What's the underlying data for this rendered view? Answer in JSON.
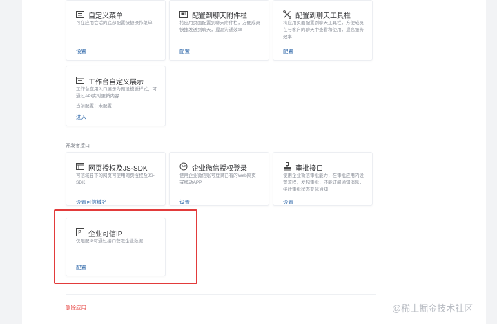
{
  "cards": [
    {
      "title": "自定义菜单",
      "desc": "可在应用会话的底部配置快捷操作菜单",
      "link": "设置",
      "icon": "menu-icon"
    },
    {
      "title": "配置到聊天附件栏",
      "desc": "将应用页面配置到聊天附件栏，方便成员快捷发送到聊天，提高沟通效率",
      "link": "配置",
      "icon": "chat-attachment-icon"
    },
    {
      "title": "配置到聊天工具栏",
      "desc": "将应用页面配置到聊天工具栏，方便成员在与客户的聊天中查看和使用，提高服务效率",
      "link": "配置",
      "icon": "chat-toolbar-icon"
    },
    {
      "title": "工作台自定义展示",
      "desc": "工作台应用入口展示为预设模板样式，可通过API实时更新内容",
      "extra": "当前配置：未配置",
      "link": "进入",
      "icon": "workbench-icon"
    }
  ],
  "section_label": "开发者接口",
  "dev_cards": [
    {
      "title": "网页授权及JS-SDK",
      "desc": "可信域名下的网页可使用网页授权及JS-SDK",
      "link": "设置可信域名",
      "icon": "web-auth-icon"
    },
    {
      "title": "企业微信授权登录",
      "desc": "使用企业微信账号登录已有的Web网页或移动APP",
      "link": "设置",
      "icon": "wecom-login-icon"
    },
    {
      "title": "审批接口",
      "desc": "使用企业微信审批能力，在审批应用内设置流程，发起审批，还能订阅通知消息，接收审批状态变化通知",
      "link": "设置",
      "icon": "approval-icon"
    },
    {
      "title": "企业可信IP",
      "desc": "仅限配IP可通过接口获取企业数据",
      "link": "配置",
      "icon": "trusted-ip-icon"
    }
  ],
  "delete_label": "删除应用",
  "watermark": "@稀土掘金技术社区",
  "colors": {
    "link": "#2c66a8",
    "danger": "#e64340",
    "highlight": "#e23b3b"
  }
}
